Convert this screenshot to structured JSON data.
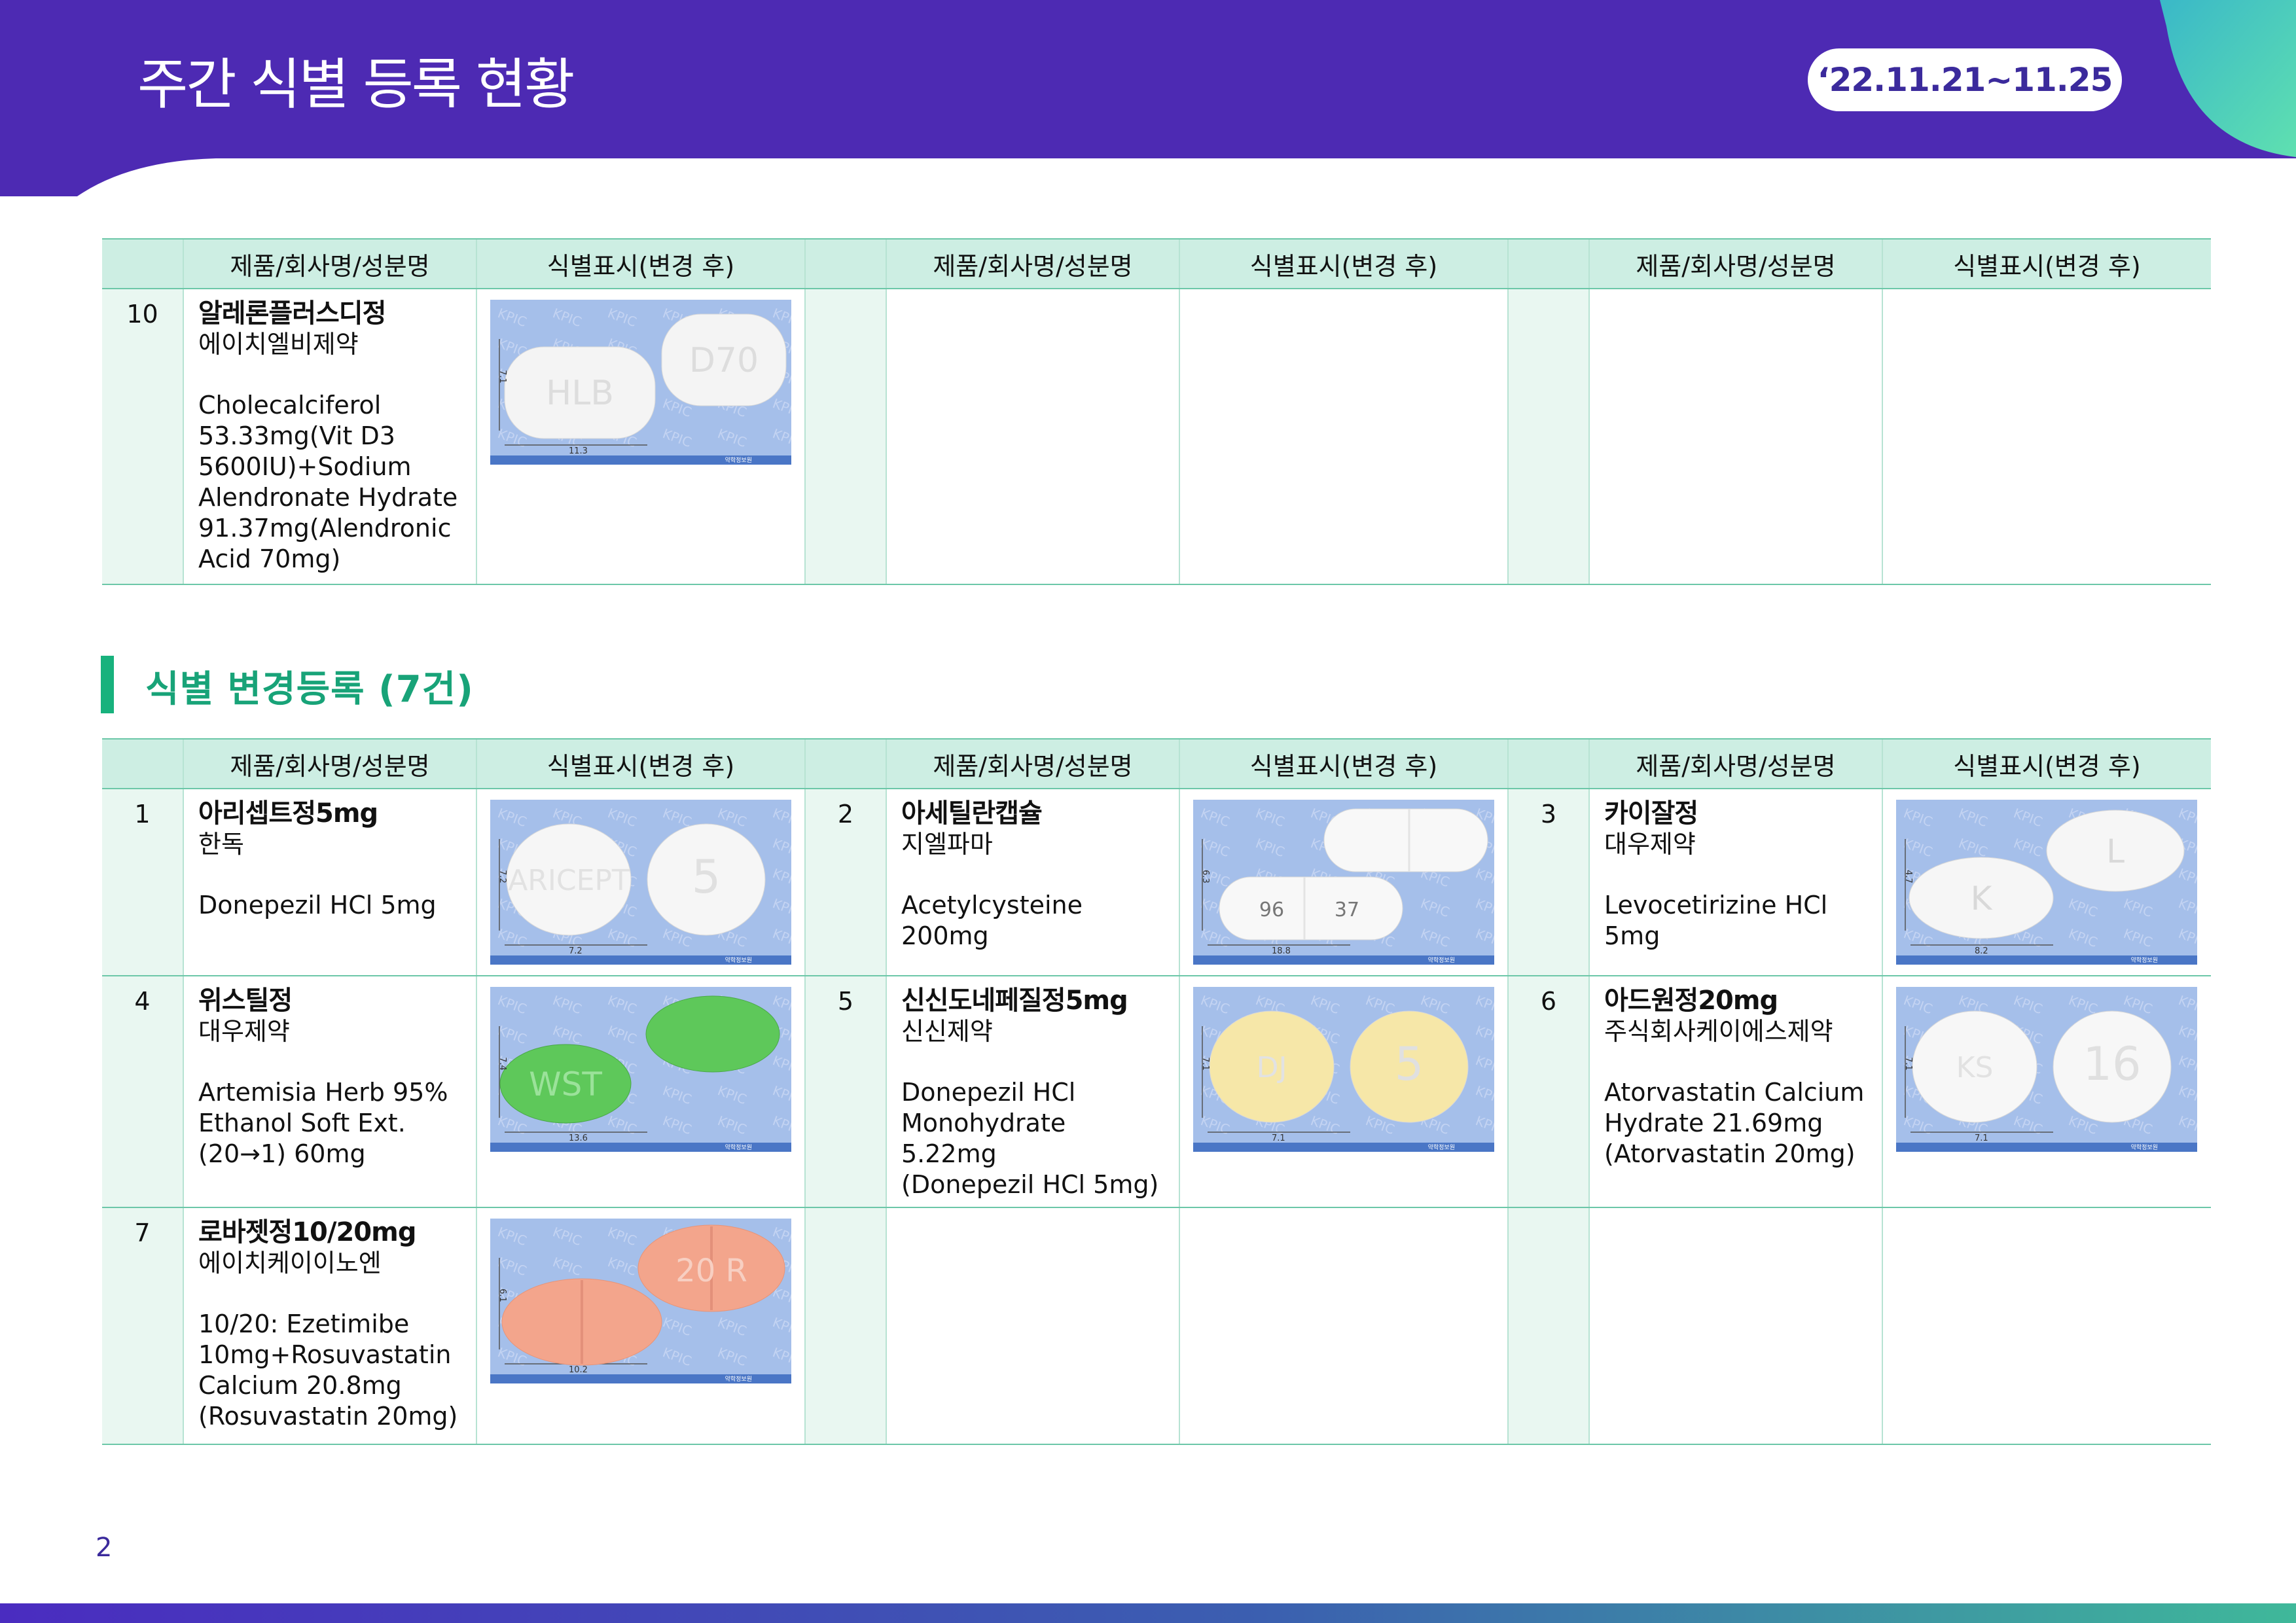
{
  "header": {
    "title": "주간 식별 등록 현황",
    "date_range": "‘22.11.21~11.25"
  },
  "columns": {
    "product": "제품/회사명/성분명",
    "marking": "식별표시(변경 후)"
  },
  "top_table": {
    "rows": [
      {
        "no": "10",
        "name": "알레론플러스디정",
        "company": "에이치엘비제약",
        "composition": "Cholecalciferol\n53.33mg(Vit D3\n5600IU)+Sodium\nAlendronate Hydrate\n91.37mg(Alendronic\nAcid 70mg)",
        "pill": {
          "marks": [
            "HLB",
            "D70"
          ],
          "width_mm": "11.3",
          "thickness_mm": "7.1",
          "color": "#f4f4f4"
        }
      }
    ]
  },
  "section": {
    "title": "식별 변경등록 (7건)"
  },
  "change_items": [
    {
      "no": "1",
      "name": "아리셉트정5mg",
      "company": "한독",
      "composition": "Donepezil HCl 5mg",
      "pill": {
        "marks": [
          "ARICEPT",
          "5"
        ],
        "width_mm": "7.2",
        "thickness_mm": "7.2",
        "color": "#f6f6f6"
      }
    },
    {
      "no": "2",
      "name": "아세틸란캡슐",
      "company": "지엘파마",
      "composition": "Acetylcysteine 200mg",
      "pill": {
        "marks": [
          "96",
          "37"
        ],
        "width_mm": "18.8",
        "thickness_mm": "6.3",
        "color": "#f8f8f8"
      }
    },
    {
      "no": "3",
      "name": "카이잘정",
      "company": "대우제약",
      "composition": "Levocetirizine HCl\n5mg",
      "pill": {
        "marks": [
          "K",
          "L"
        ],
        "width_mm": "8.2",
        "thickness_mm": "4.7",
        "color": "#f6f6f6"
      }
    },
    {
      "no": "4",
      "name": "위스틸정",
      "company": "대우제약",
      "composition": "Artemisia Herb 95%\nEthanol Soft Ext.\n(20→1) 60mg",
      "pill": {
        "marks": [
          "WST",
          ""
        ],
        "width_mm": "13.6",
        "thickness_mm": "7.4",
        "color": "#5ec85a"
      }
    },
    {
      "no": "5",
      "name": "신신도네페질정5mg",
      "company": "신신제약",
      "composition": "Donepezil HCl\nMonohydrate 5.22mg\n(Donepezil HCl 5mg)",
      "pill": {
        "marks": [
          "DJ",
          "5"
        ],
        "width_mm": "7.1",
        "thickness_mm": "7.1",
        "color": "#f6e7a8"
      }
    },
    {
      "no": "6",
      "name": "아드원정20mg",
      "company": "주식회사케이에스제약",
      "composition": "Atorvastatin Calcium\nHydrate 21.69mg\n(Atorvastatin 20mg)",
      "pill": {
        "marks": [
          "KS",
          "16"
        ],
        "width_mm": "7.1",
        "thickness_mm": "7.1",
        "color": "#f7f7f7"
      }
    },
    {
      "no": "7",
      "name": "로바젯정10/20mg",
      "company": "에이치케이이노엔",
      "composition": "10/20: Ezetimibe\n10mg+Rosuvastatin\nCalcium 20.8mg\n(Rosuvastatin 20mg)",
      "pill": {
        "marks": [
          "",
          "20 R"
        ],
        "width_mm": "10.2",
        "thickness_mm": "6.1",
        "color": "#f3a58c"
      }
    }
  ],
  "image_caption": "약학정보원",
  "page_number": "2"
}
